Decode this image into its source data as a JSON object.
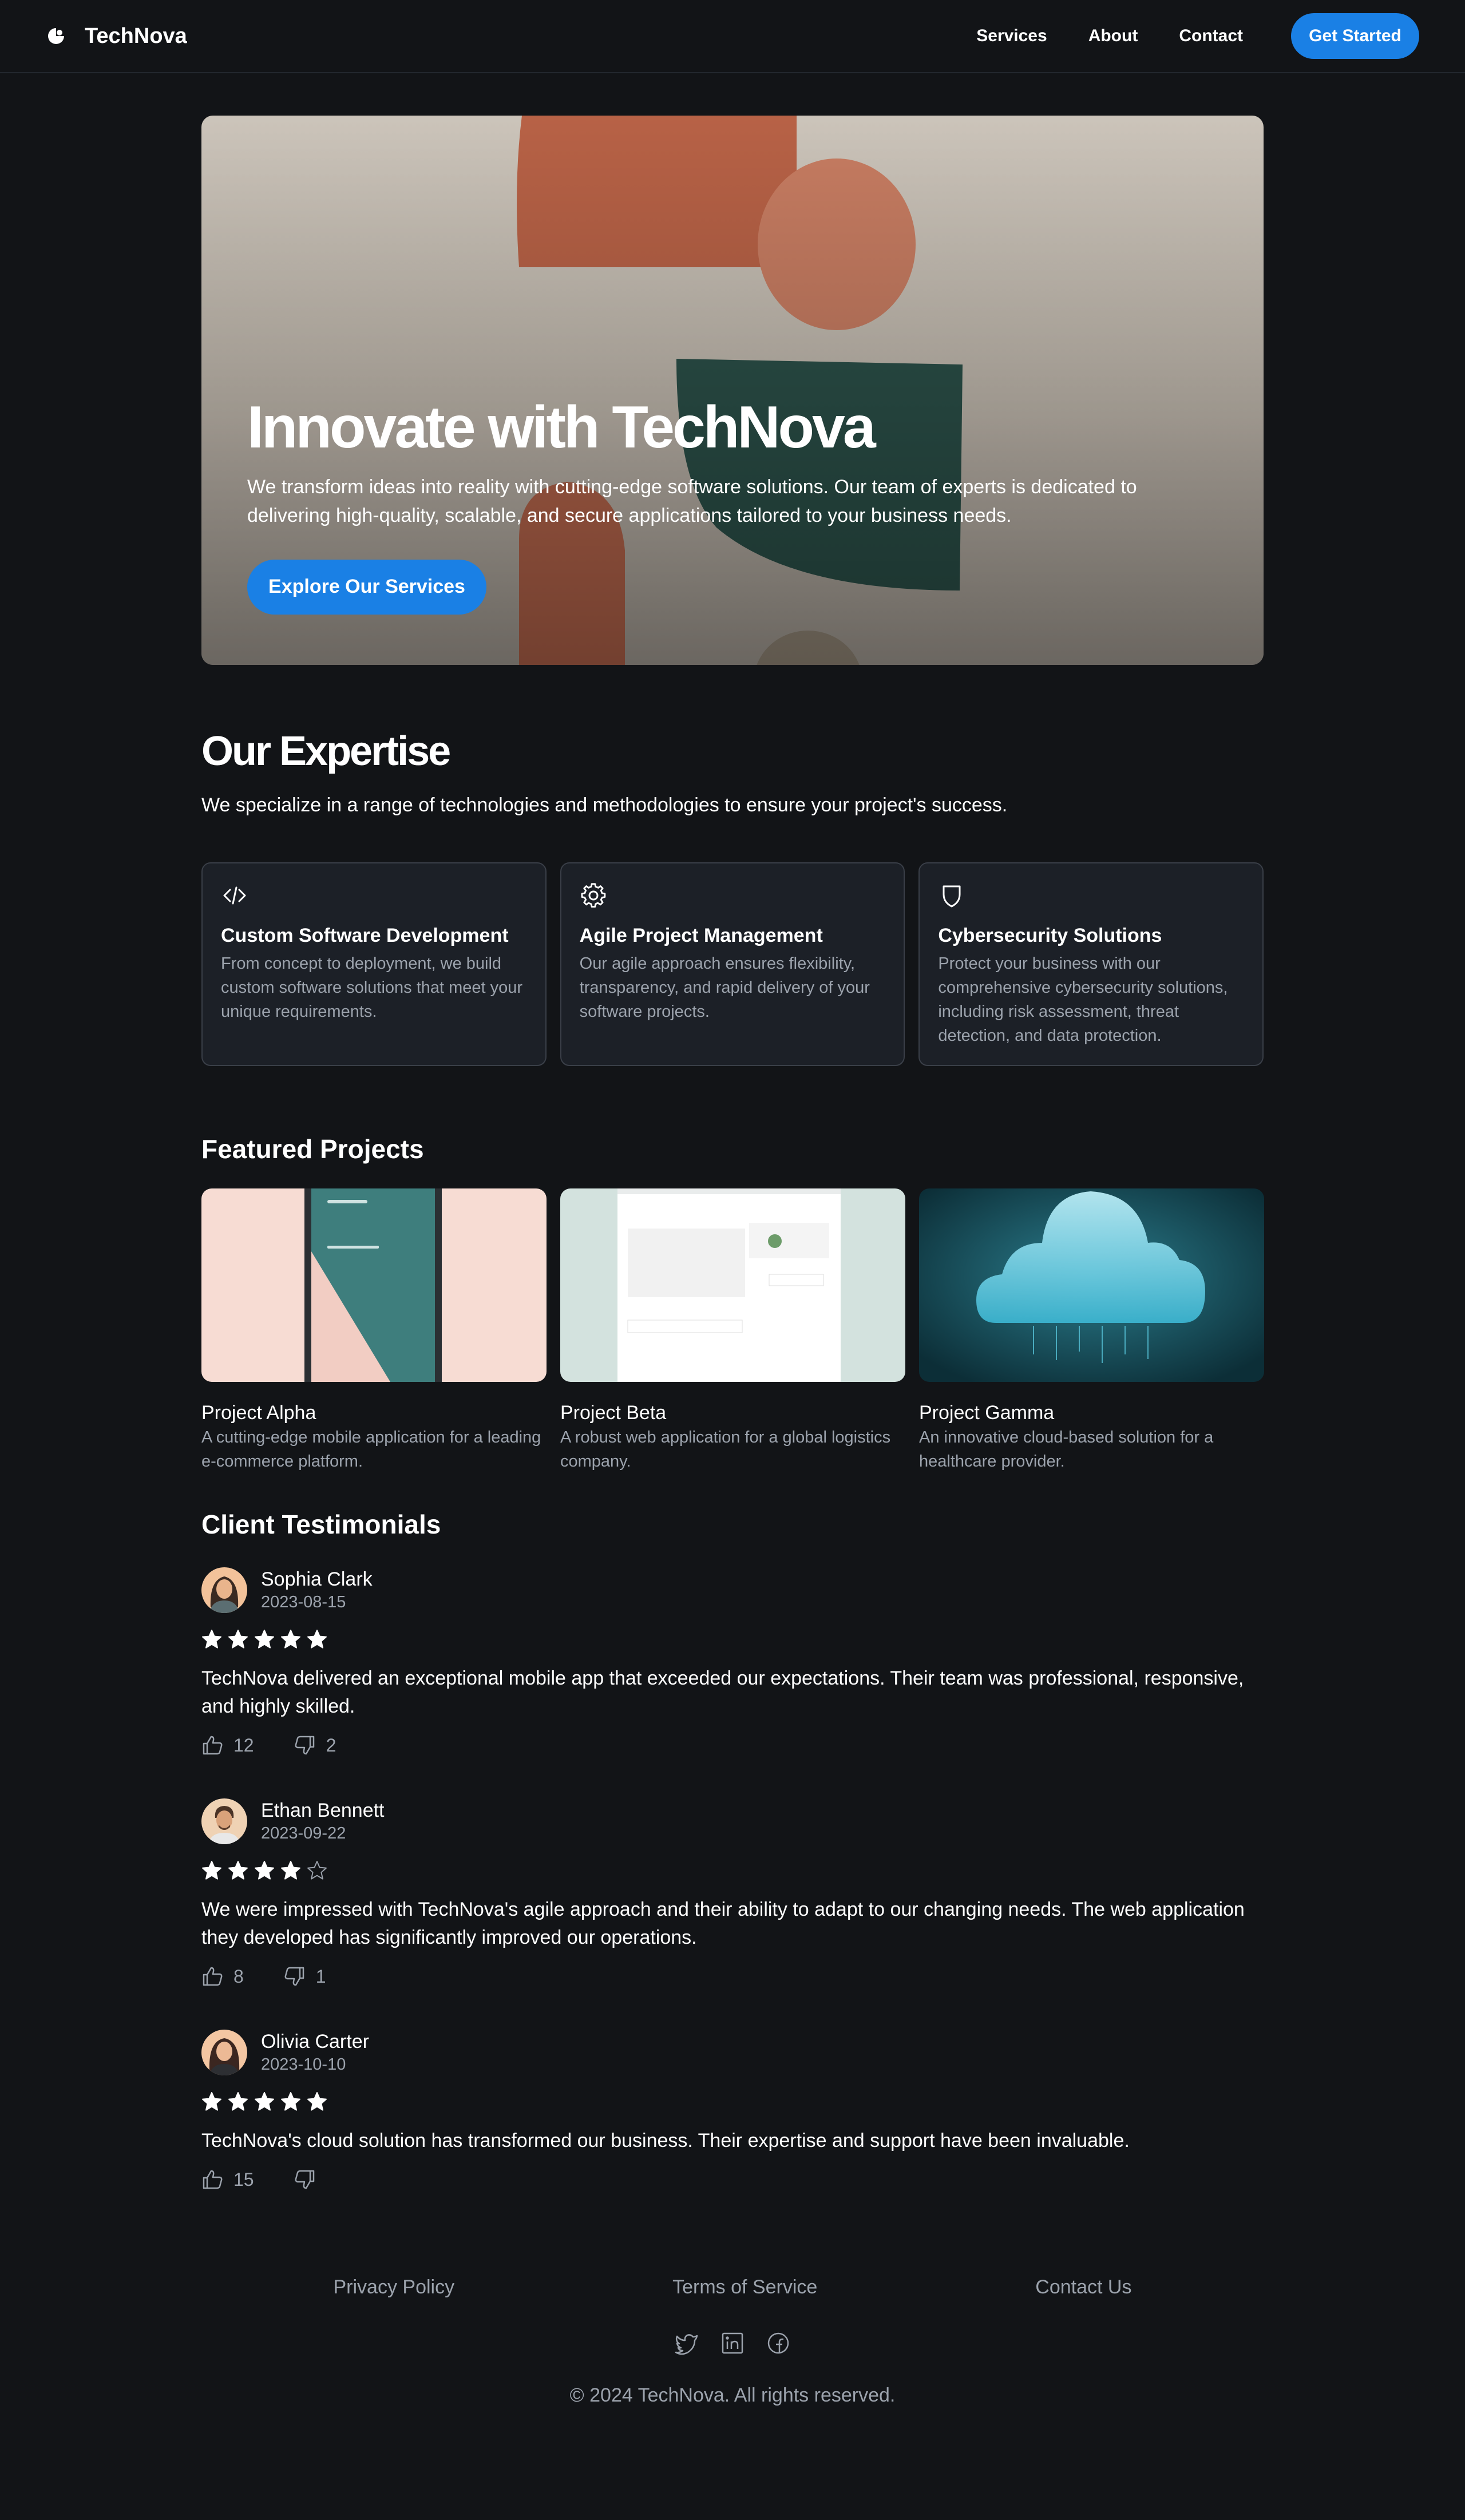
{
  "header": {
    "brand": "TechNova",
    "nav": [
      "Services",
      "About",
      "Contact"
    ],
    "cta": "Get Started"
  },
  "hero": {
    "title": "Innovate with TechNova",
    "subtitle": "We transform ideas into reality with cutting-edge software solutions. Our team of experts is dedicated to delivering high-quality, scalable, and secure applications tailored to your business needs.",
    "button": "Explore Our Services"
  },
  "expertise": {
    "title": "Our Expertise",
    "lead": "We specialize in a range of technologies and methodologies to ensure your project's success.",
    "cards": [
      {
        "icon": "code-icon",
        "title": "Custom Software Development",
        "text": "From concept to deployment, we build custom software solutions that meet your unique requirements."
      },
      {
        "icon": "gear-icon",
        "title": "Agile Project Management",
        "text": "Our agile approach ensures flexibility, transparency, and rapid delivery of your software projects."
      },
      {
        "icon": "shield-icon",
        "title": "Cybersecurity Solutions",
        "text": "Protect your business with our comprehensive cybersecurity solutions, including risk assessment, threat detection, and data protection."
      }
    ]
  },
  "projects": {
    "title": "Featured Projects",
    "items": [
      {
        "title": "Project Alpha",
        "text": "A cutting-edge mobile application for a leading e-commerce platform."
      },
      {
        "title": "Project Beta",
        "text": "A robust web application for a global logistics company."
      },
      {
        "title": "Project Gamma",
        "text": "An innovative cloud-based solution for a healthcare provider."
      }
    ]
  },
  "testimonials": {
    "title": "Client Testimonials",
    "items": [
      {
        "name": "Sophia Clark",
        "date": "2023-08-15",
        "rating": 5,
        "text": "TechNova delivered an exceptional mobile app that exceeded our expectations. Their team was professional, responsive, and highly skilled.",
        "likes": "12",
        "dislikes": "2"
      },
      {
        "name": "Ethan Bennett",
        "date": "2023-09-22",
        "rating": 4,
        "text": "We were impressed with TechNova's agile approach and their ability to adapt to our changing needs. The web application they developed has significantly improved our operations.",
        "likes": "8",
        "dislikes": "1"
      },
      {
        "name": "Olivia Carter",
        "date": "2023-10-10",
        "rating": 5,
        "text": "TechNova's cloud solution has transformed our business. Their expertise and support have been invaluable.",
        "likes": "15",
        "dislikes": ""
      }
    ]
  },
  "footer": {
    "links": [
      "Privacy Policy",
      "Terms of Service",
      "Contact Us"
    ],
    "social": [
      "twitter-icon",
      "linkedin-icon",
      "facebook-icon"
    ],
    "copyright": "© 2024 TechNova. All rights reserved."
  },
  "colors": {
    "background": "#121417",
    "accent": "#1a80e5",
    "card": "#1c2027",
    "muted_text": "#9ca3ad"
  }
}
